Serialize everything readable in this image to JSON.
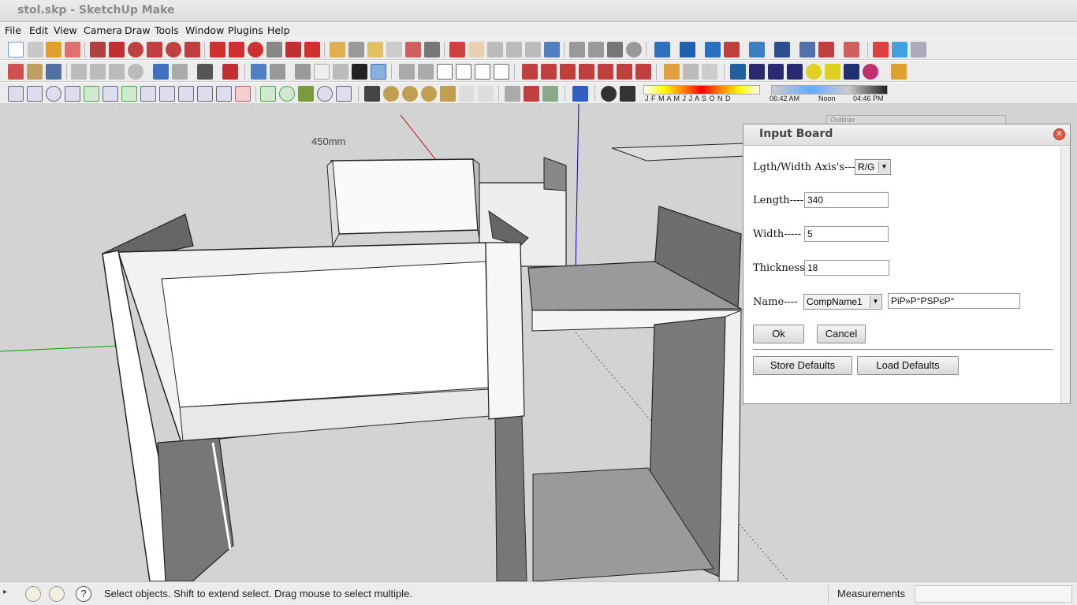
{
  "window": {
    "title": "stol.skp - SketchUp Make"
  },
  "menu": [
    "File",
    "Edit",
    "View",
    "Camera",
    "Draw",
    "Tools",
    "Window",
    "Plugins",
    "Help"
  ],
  "shadow_bar": {
    "months": "J F M A M J J A S O N D",
    "time_start": "06:42 AM",
    "time_mid": "Noon",
    "time_end": "04:46 PM"
  },
  "viewport": {
    "dimension_label": "450mm",
    "outliner_ghost": "Outliner"
  },
  "dialog": {
    "title": "Input Board",
    "axis_label": "Lgth/Width Axis's---",
    "axis_value": "R/G",
    "length_label": "Length----",
    "length_value": "340",
    "width_label": "Width-----",
    "width_value": "5",
    "thickness_label": "Thickness-",
    "thickness_value": "18",
    "name_label": "Name----",
    "name_select": "CompName1",
    "name_value": "РіР»Р°РЅРєР°",
    "ok": "Ok",
    "cancel": "Cancel",
    "store": "Store Defaults",
    "load": "Load Defaults"
  },
  "status": {
    "hint": "Select objects. Shift to extend select. Drag mouse to select multiple.",
    "measurements_label": "Measurements",
    "measurements_value": ""
  },
  "colors": {
    "x_axis": "#d00000",
    "y_axis": "#00a000",
    "z_axis": "#0000d0",
    "accent_close": "#e05a3a"
  }
}
